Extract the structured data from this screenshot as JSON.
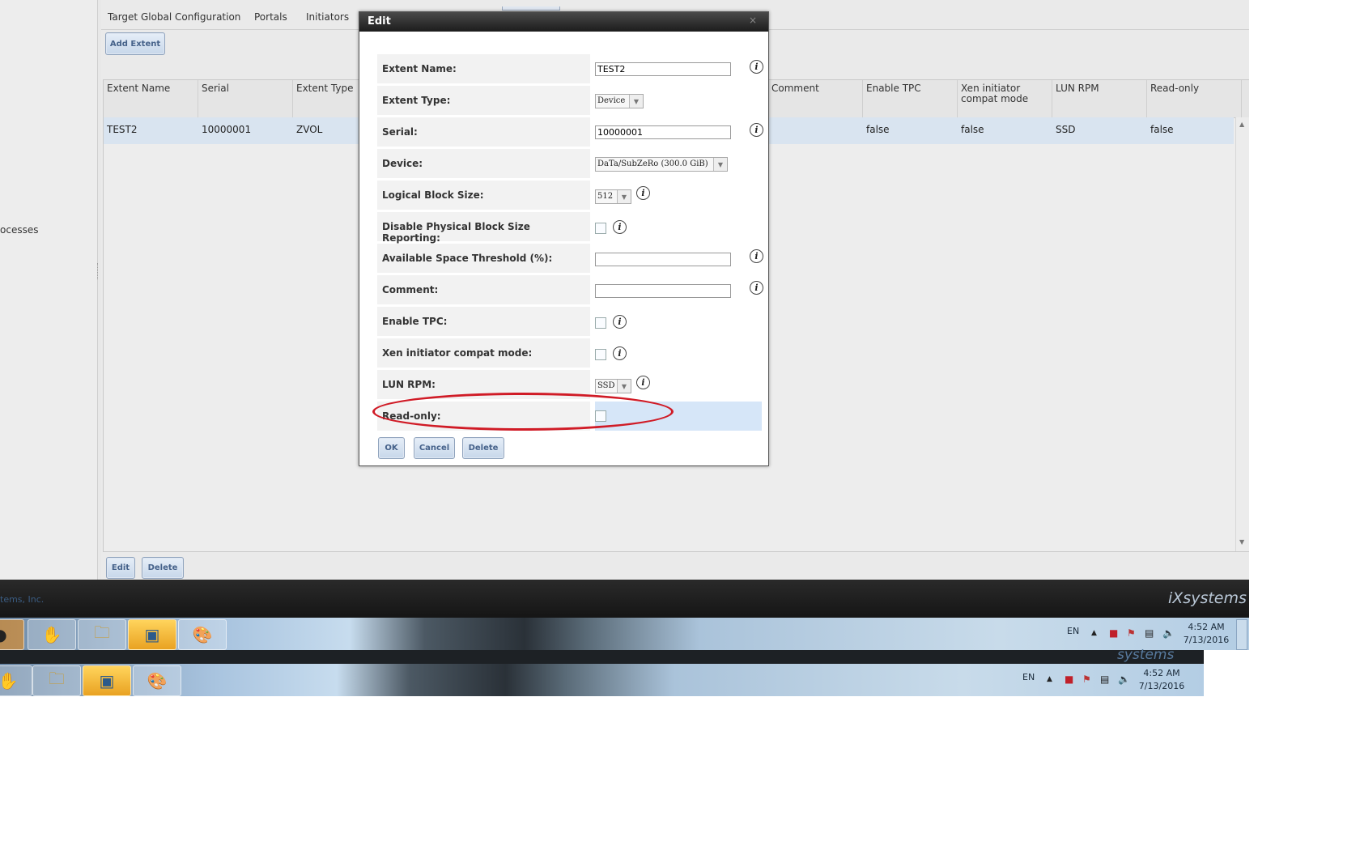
{
  "main": {
    "tabs": [
      "Target Global Configuration",
      "Portals",
      "Initiators"
    ],
    "add_extent": "Add Extent",
    "left_text": "ocesses",
    "columns": [
      "Extent Name",
      "Serial",
      "Extent Type",
      "Comment",
      "Enable TPC",
      "Xen initiator compat mode",
      "LUN RPM",
      "Read-only"
    ],
    "row": {
      "extent_name": "TEST2",
      "serial": "10000001",
      "extent_type": "ZVOL",
      "enable_tpc": "false",
      "xen": "false",
      "lun_rpm": "SSD",
      "read_only": "false"
    },
    "edit_button": "Edit",
    "delete_button": "Delete",
    "footer_copy": "tems, Inc.",
    "brand": "iXsystems"
  },
  "modal": {
    "title": "Edit",
    "close": "×",
    "fields": {
      "extent_name_label": "Extent Name:",
      "extent_name_value": "TEST2",
      "extent_type_label": "Extent Type:",
      "extent_type_value": "Device",
      "serial_label": "Serial:",
      "serial_value": "10000001",
      "device_label": "Device:",
      "device_value": "DaTa/SubZeRo (300.0 GiB)",
      "block_size_label": "Logical Block Size:",
      "block_size_value": "512",
      "disable_pbs_label": "Disable Physical Block Size Reporting:",
      "avail_space_label": "Available Space Threshold (%):",
      "avail_space_value": "",
      "comment_label": "Comment:",
      "comment_value": "",
      "enable_tpc_label": "Enable TPC:",
      "xen_label": "Xen initiator compat mode:",
      "lun_rpm_label": "LUN RPM:",
      "lun_rpm_value": "SSD",
      "read_only_label": "Read-only:"
    },
    "info_glyph": "i",
    "ok": "OK",
    "cancel": "Cancel",
    "delete": "Delete"
  },
  "taskbar": {
    "lang": "EN",
    "time": "4:52 AM",
    "date": "7/13/2016",
    "ghost_brand": "systems"
  }
}
